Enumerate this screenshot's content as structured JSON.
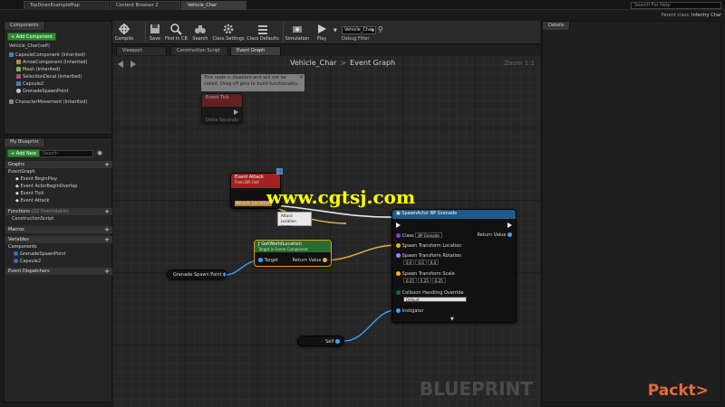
{
  "tabs": [
    "TopDownExampleMap",
    "Content Browser 2",
    "Vehicle_Char"
  ],
  "search_help_placeholder": "Search For Help",
  "parent_class_label": "Parent class:",
  "parent_class_value": "Infantry Char",
  "components": {
    "tab": "Components",
    "add_label": "+ Add Component",
    "self_label": "Vehicle_Char(self)",
    "items": [
      "CapsuleComponent (Inherited)",
      "ArrowComponent (Inherited)",
      "Mesh (Inherited)",
      "SelectionDecal (Inherited)",
      "Capsule2",
      "GrenadeSpawnPoint",
      "CharacterMovement (Inherited)"
    ]
  },
  "my_blueprint": {
    "tab": "My Blueprint",
    "add_label": "+ Add New",
    "search_placeholder": "Search",
    "graphs_header": "Graphs",
    "graph_name": "EventGraph",
    "events": [
      "Event BeginPlay",
      "Event ActorBeginOverlap",
      "Event Tick",
      "Event Attack"
    ],
    "functions_header": "Functions",
    "functions_count": "(22 Overridable)",
    "function_item": "ConstructionScript",
    "macros_header": "Macros",
    "variables_header": "Variables",
    "components_header": "Components",
    "component_vars": [
      "GrenadeSpawnPoint",
      "Capsule2"
    ],
    "dispatchers_header": "Event Dispatchers"
  },
  "toolbar": {
    "buttons": [
      "Compile",
      "Save",
      "Find in CB",
      "Search",
      "Class Settings",
      "Class Defaults",
      "Simulation",
      "Play"
    ],
    "debug_value": "Vehicle_Char",
    "debug_label": "Debug Filter"
  },
  "editor_tabs": [
    "Viewport",
    "Construction Script",
    "Event Graph"
  ],
  "graph": {
    "breadcrumb_root": "Vehicle_Char",
    "breadcrumb_current": "Event Graph",
    "zoom": "Zoom 1:1",
    "watermark": "BLUEPRINT",
    "disabled_note": "This node is disabled and will not be called. Drag off pins to build functionality.",
    "site_watermark": "www.cgtsj.com",
    "tooltip_title": "Attack Location",
    "tooltip_type": "Vector"
  },
  "nodes": {
    "event_tick": {
      "title": "Event Tick",
      "pin": "Delta Seconds"
    },
    "event_attack": {
      "title": "Event Attack",
      "subtitle": "From BPI Unit",
      "pin": "Attack Location"
    },
    "get_world_location": {
      "title": "GetWorldLocation",
      "subtitle": "Target is Scene Component",
      "target": "Target",
      "ret": "Return Value"
    },
    "grenade_spawn_point": {
      "label": "Grenade Spawn Point"
    },
    "self": {
      "label": "Self"
    },
    "spawn_actor": {
      "title": "SpawnActor BP Grenade",
      "class_label": "Class",
      "class_value": "BP Grenade",
      "return_label": "Return Value",
      "transform_location": "Spawn Transform Location",
      "transform_rotation": "Spawn Transform Rotation",
      "rotation_values": [
        "0.0",
        "0.0",
        "0.0"
      ],
      "transform_scale": "Spawn Transform Scale",
      "scale_values": [
        "0.25",
        "0.25",
        "0.25"
      ],
      "collision_label": "Collision Handling Override",
      "collision_value": "Default",
      "instigator": "Instigator"
    }
  },
  "details": {
    "tab": "Details"
  },
  "brand": "Packt>"
}
